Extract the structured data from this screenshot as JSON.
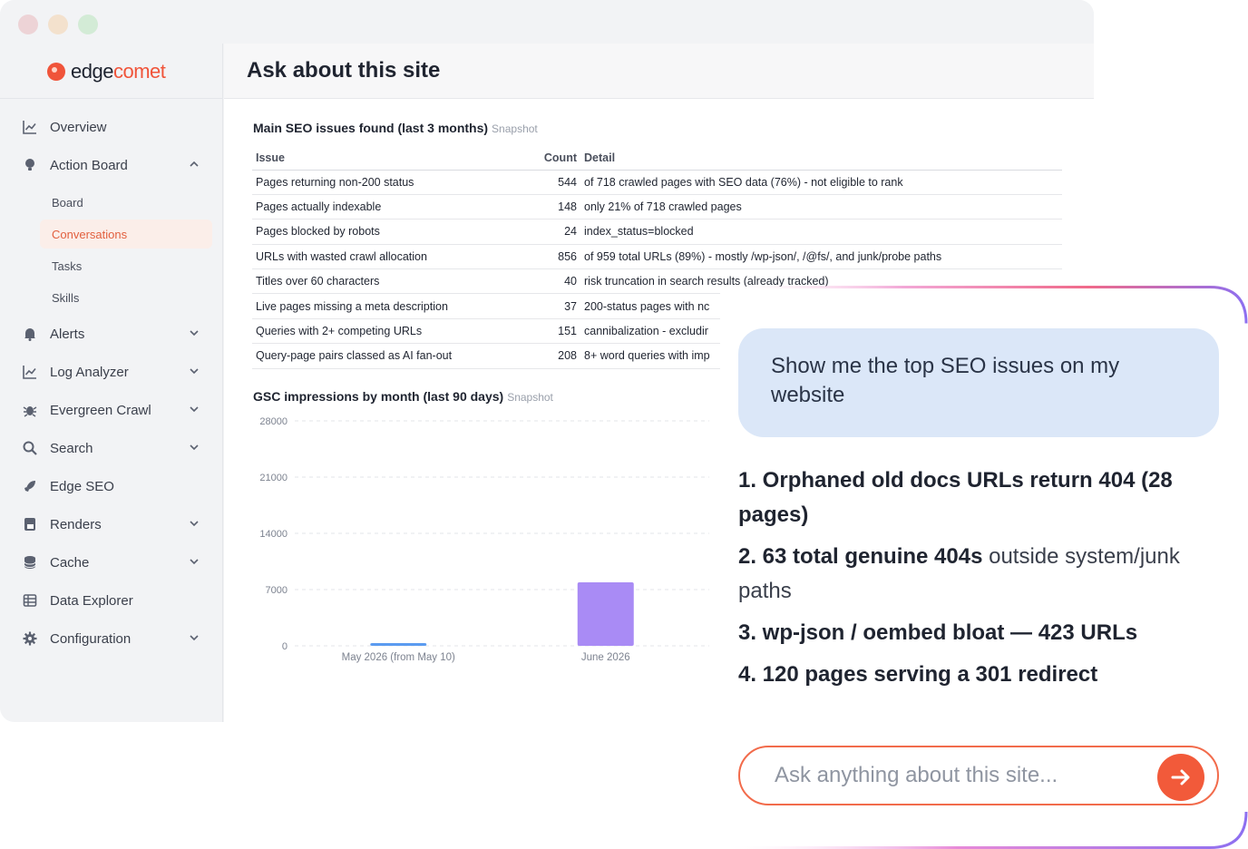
{
  "brand": {
    "name_part1": "edge",
    "name_part2": "comet",
    "accent": "#f0543a"
  },
  "sidebar": {
    "items": [
      {
        "label": "Overview",
        "icon": "line-chart-icon"
      },
      {
        "label": "Action Board",
        "icon": "lightbulb-icon",
        "expanded": true
      },
      {
        "label": "Alerts",
        "icon": "bell-icon"
      },
      {
        "label": "Log Analyzer",
        "icon": "line-chart-icon"
      },
      {
        "label": "Evergreen Crawl",
        "icon": "bug-icon"
      },
      {
        "label": "Search",
        "icon": "search-icon"
      },
      {
        "label": "Edge SEO",
        "icon": "rocket-icon"
      },
      {
        "label": "Renders",
        "icon": "js-file-icon"
      },
      {
        "label": "Cache",
        "icon": "database-icon"
      },
      {
        "label": "Data Explorer",
        "icon": "table-icon"
      },
      {
        "label": "Configuration",
        "icon": "gear-icon"
      }
    ],
    "sub_items": [
      {
        "label": "Board"
      },
      {
        "label": "Conversations",
        "active": true
      },
      {
        "label": "Tasks"
      },
      {
        "label": "Skills"
      }
    ]
  },
  "main": {
    "title": "Ask about this site",
    "table_section": {
      "title": "Main SEO issues found (last 3 months)",
      "badge": "Snapshot"
    },
    "table": {
      "headers": [
        "Issue",
        "Count",
        "Detail"
      ],
      "rows": [
        {
          "issue": "Pages returning non-200 status",
          "count": "544",
          "detail": "of 718 crawled pages with SEO data (76%) - not eligible to rank"
        },
        {
          "issue": "Pages actually indexable",
          "count": "148",
          "detail": "only 21% of 718 crawled pages"
        },
        {
          "issue": "Pages blocked by robots",
          "count": "24",
          "detail": "index_status=blocked"
        },
        {
          "issue": "URLs with wasted crawl allocation",
          "count": "856",
          "detail": "of 959 total URLs (89%) - mostly /wp-json/, /@fs/, and junk/probe paths"
        },
        {
          "issue": "Titles over 60 characters",
          "count": "40",
          "detail": "risk truncation in search results (already tracked)"
        },
        {
          "issue": "Live pages missing a meta description",
          "count": "37",
          "detail": "200-status pages with nc"
        },
        {
          "issue": "Queries with 2+ competing URLs",
          "count": "151",
          "detail": "cannibalization - excludir"
        },
        {
          "issue": "Query-page pairs classed as AI fan-out",
          "count": "208",
          "detail": "8+ word queries with imp"
        }
      ]
    },
    "chart_section": {
      "title": "GSC impressions by month (last 90 days)",
      "badge": "Snapshot"
    }
  },
  "chart_data": {
    "type": "bar",
    "title": "GSC impressions by month (last 90 days)",
    "categories": [
      "May 2026 (from May 10)",
      "June 2026"
    ],
    "series": [
      {
        "values": [
          280,
          7900
        ],
        "colors": [
          "#5b9bf0",
          "#a98bf5"
        ]
      }
    ],
    "ylim": [
      0,
      28000
    ],
    "yticks": [
      "0",
      "7000",
      "14000",
      "21000",
      "28000"
    ],
    "xlabel": "",
    "ylabel": "",
    "grid": true
  },
  "chat": {
    "user_message": "Show me the top SEO issues on my website",
    "answer_items": [
      {
        "bold": "1. Orphaned old docs URLs return 404 (28 pages)",
        "rest": ""
      },
      {
        "bold": "2. 63 total genuine 404s",
        "rest": " outside system/junk paths"
      },
      {
        "bold": "3. wp-json / oembed bloat — 423 URLs",
        "rest": ""
      },
      {
        "bold": "4. 120 pages serving a 301 redirect",
        "rest": ""
      }
    ],
    "input_placeholder": "Ask anything about this site...",
    "send_icon": "arrow-right-icon"
  }
}
